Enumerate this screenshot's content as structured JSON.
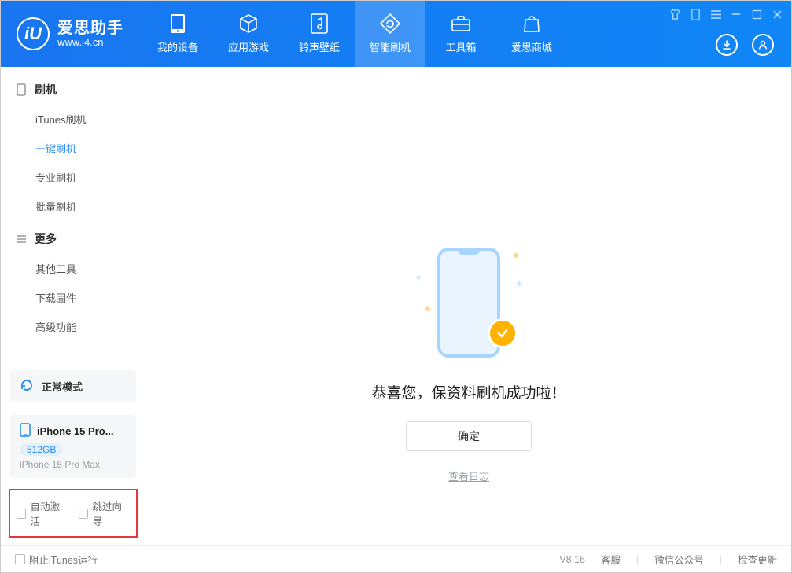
{
  "app": {
    "name": "爱思助手",
    "url": "www.i4.cn"
  },
  "nav": {
    "items": [
      {
        "label": "我的设备"
      },
      {
        "label": "应用游戏"
      },
      {
        "label": "铃声壁纸"
      },
      {
        "label": "智能刷机"
      },
      {
        "label": "工具箱"
      },
      {
        "label": "爱思商城"
      }
    ]
  },
  "sidebar": {
    "section1": {
      "title": "刷机",
      "items": [
        "iTunes刷机",
        "一键刷机",
        "专业刷机",
        "批量刷机"
      ]
    },
    "section2": {
      "title": "更多",
      "items": [
        "其他工具",
        "下载固件",
        "高级功能"
      ]
    }
  },
  "status": {
    "mode": "正常模式"
  },
  "device": {
    "name": "iPhone 15 Pro...",
    "storage": "512GB",
    "full": "iPhone 15 Pro Max"
  },
  "checks": {
    "auto_activate": "自动激活",
    "skip_guide": "跳过向导"
  },
  "main": {
    "success": "恭喜您，保资料刷机成功啦！",
    "ok": "确定",
    "view_log": "查看日志"
  },
  "footer": {
    "block_itunes": "阻止iTunes运行",
    "version": "V8.16",
    "support": "客服",
    "wechat": "微信公众号",
    "check_update": "检查更新"
  }
}
